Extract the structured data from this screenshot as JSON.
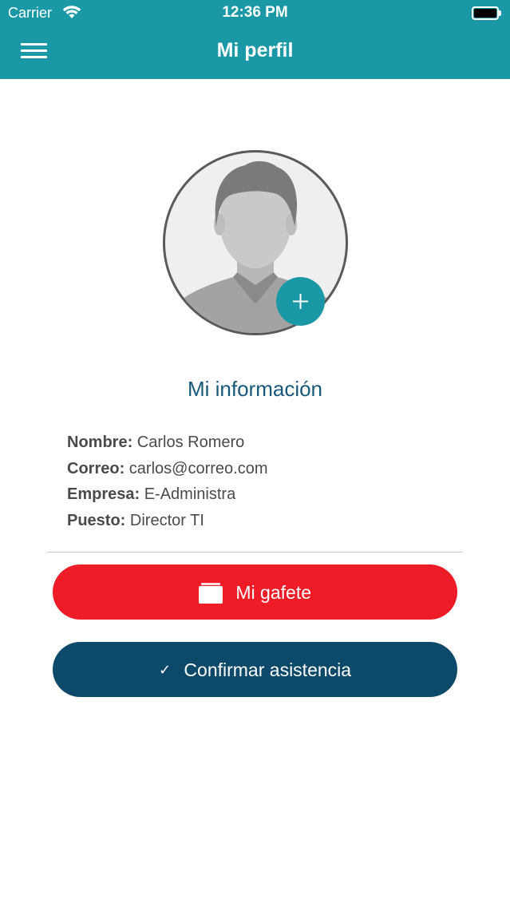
{
  "status_bar": {
    "carrier": "Carrier",
    "time": "12:36 PM"
  },
  "header": {
    "title": "Mi perfil",
    "background": "#1a98a6"
  },
  "profile": {
    "avatar_icon": "default-user-silhouette",
    "add_photo_icon": "plus-icon"
  },
  "info": {
    "title": "Mi información",
    "rows": [
      {
        "label": "Nombre:",
        "value": "Carlos Romero"
      },
      {
        "label": "Correo:",
        "value": "carlos@correo.com"
      },
      {
        "label": "Empresa:",
        "value": "E-Administra"
      },
      {
        "label": "Puesto:",
        "value": "Director TI"
      }
    ]
  },
  "actions": {
    "badge_label": "Mi gafete",
    "badge_icon": "id-card-icon",
    "badge_color": "#ee1c27",
    "confirm_check": "✓",
    "confirm_label": "Confirmar asistencia",
    "confirm_color": "#0d4968"
  }
}
